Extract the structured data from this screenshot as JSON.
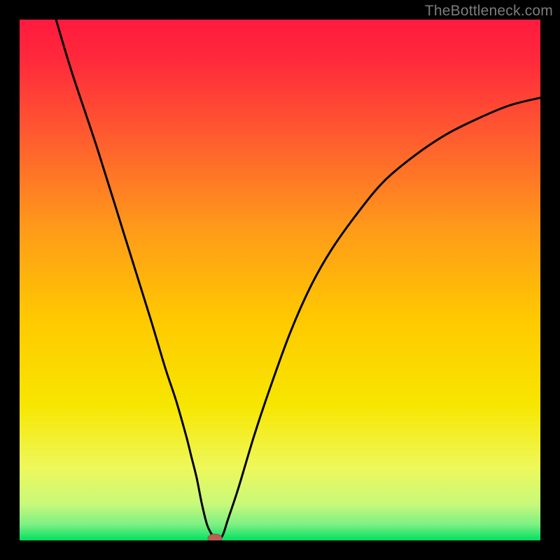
{
  "attribution": "TheBottleneck.com",
  "chart_data": {
    "type": "line",
    "title": "",
    "xlabel": "",
    "ylabel": "",
    "xlim": [
      0,
      100
    ],
    "ylim": [
      0,
      100
    ],
    "colors": {
      "top": "#ff1a3f",
      "mid": "#ffd400",
      "bottom": "#00e060",
      "curve": "#000000",
      "marker": "#c05a50"
    },
    "series": [
      {
        "name": "bottleneck-curve",
        "x": [
          7,
          10,
          15,
          20,
          25,
          28,
          30,
          32,
          33,
          34,
          35,
          36,
          37,
          38,
          39,
          40,
          42,
          45,
          48,
          52,
          56,
          60,
          65,
          70,
          76,
          82,
          88,
          94,
          100
        ],
        "y": [
          100,
          90,
          75,
          59,
          43,
          33,
          27,
          20,
          16,
          12,
          7,
          3,
          1,
          0,
          1,
          4,
          10,
          20,
          29,
          40,
          49,
          56,
          63,
          69,
          74,
          78,
          81,
          83.5,
          85
        ]
      }
    ],
    "marker": {
      "x": 37.5,
      "y": 0
    }
  }
}
